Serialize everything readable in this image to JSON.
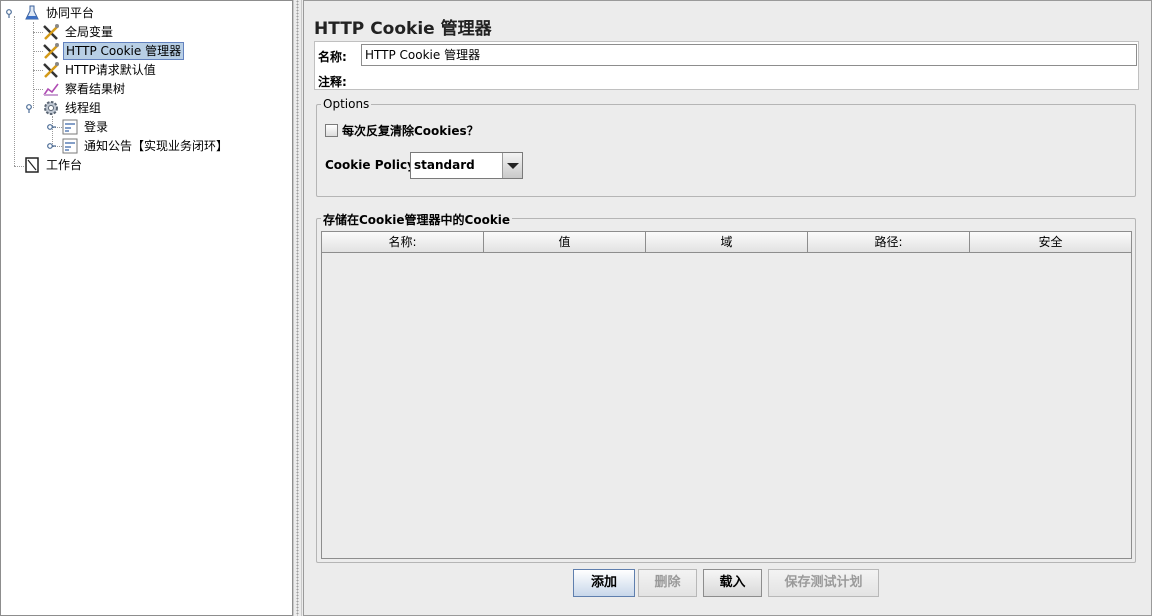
{
  "tree": {
    "items": [
      {
        "label": "协同平台"
      },
      {
        "label": "全局变量"
      },
      {
        "label": "HTTP Cookie 管理器"
      },
      {
        "label": "HTTP请求默认值"
      },
      {
        "label": "察看结果树"
      },
      {
        "label": "线程组"
      },
      {
        "label": "登录"
      },
      {
        "label": "通知公告【实现业务闭环】"
      },
      {
        "label": "工作台"
      }
    ]
  },
  "main": {
    "title": "HTTP Cookie 管理器",
    "name_label": "名称:",
    "name_value": "HTTP Cookie 管理器",
    "comment_label": "注释:",
    "comment_value": ""
  },
  "options": {
    "title": "Options",
    "clear_label": "每次反复清除Cookies？",
    "clear_checked": false,
    "policy_label": "Cookie Policy:",
    "policy_value": "standard"
  },
  "cookies": {
    "title": "存储在Cookie管理器中的Cookie",
    "columns": [
      "名称:",
      "值",
      "域",
      "路径:",
      "安全"
    ],
    "rows": []
  },
  "buttons": {
    "add": "添加",
    "delete": "删除",
    "load": "载入",
    "save": "保存测试计划"
  },
  "colors": {
    "selection_bg": "#b8cfe5",
    "panel_bg": "#ececec"
  }
}
